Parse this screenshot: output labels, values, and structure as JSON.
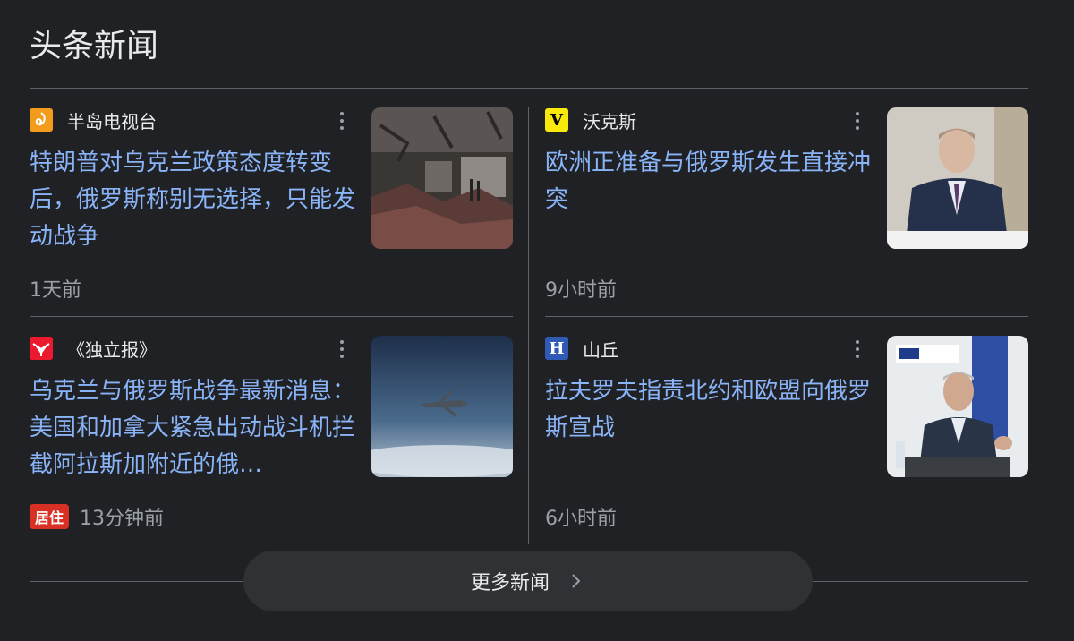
{
  "section": {
    "title": "头条新闻"
  },
  "articles": [
    {
      "source": "半岛电视台",
      "source_icon": "al-jazeera-logo-icon",
      "headline": "特朗普对乌克兰政策态度转变后，俄罗斯称别无选择，只能发动战争",
      "time": "1天前",
      "thumbnail": "destroyed-building-photo"
    },
    {
      "source": "沃克斯",
      "source_icon": "vox-logo-icon",
      "logo_letter": "V",
      "headline": "欧洲正准备与俄罗斯发生直接冲突",
      "time": "9小时前",
      "thumbnail": "man-in-suit-photo"
    },
    {
      "source": "《独立报》",
      "source_icon": "independent-eagle-logo-icon",
      "headline": "乌克兰与俄罗斯战争最新消息：美国和加拿大紧急出动战斗机拦截阿拉斯加附近的俄…",
      "live_badge": "居住",
      "time": "13分钟前",
      "thumbnail": "aircraft-in-sky-photo"
    },
    {
      "source": "山丘",
      "source_icon": "the-hill-logo-icon",
      "logo_letter": "H",
      "headline": "拉夫罗夫指责北约和欧盟向俄罗斯宣战",
      "time": "6小时前",
      "thumbnail": "speaker-at-podium-photo"
    }
  ],
  "footer": {
    "more_news_label": "更多新闻"
  },
  "colors": {
    "background": "#202124",
    "headline": "#8ab4f8",
    "muted": "#9aa0a6",
    "live_badge": "#d93025"
  }
}
